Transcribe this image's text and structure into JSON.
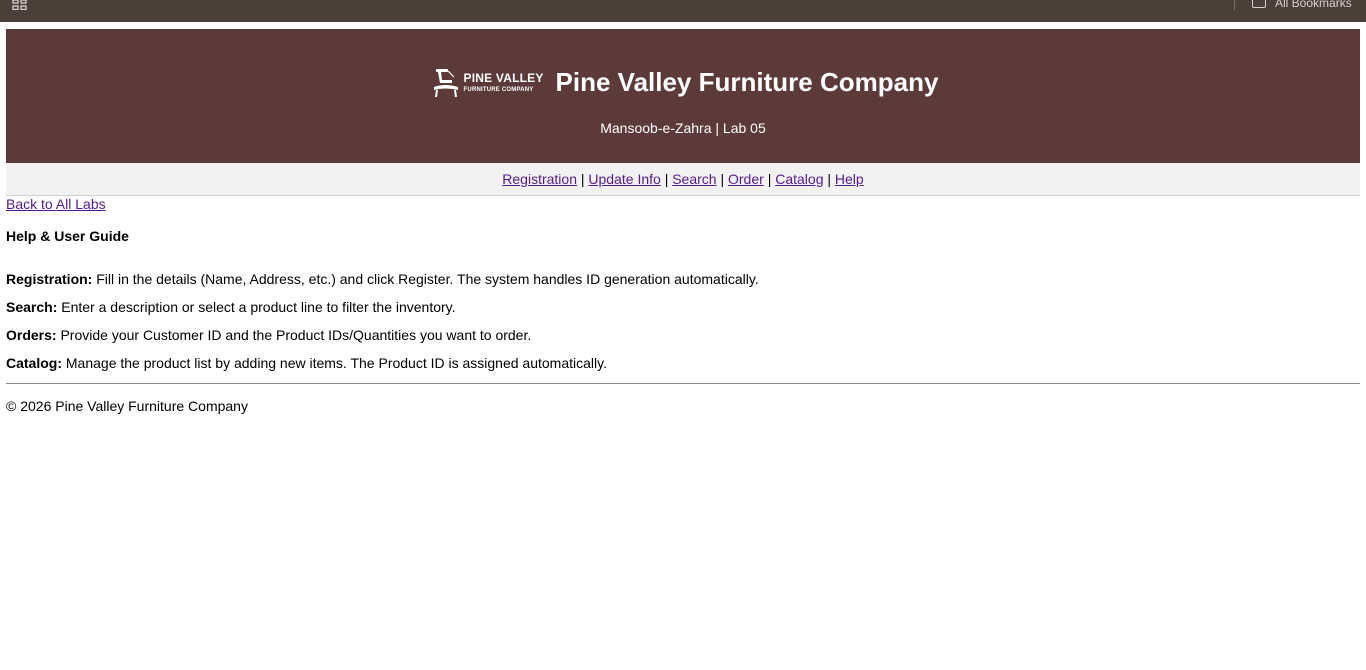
{
  "browser": {
    "bookmarks_label": "All Bookmarks"
  },
  "header": {
    "logo_name": "PINE VALLEY",
    "logo_sub": "FURNITURE COMPANY",
    "title": "Pine Valley Furniture Company",
    "subtitle": "Mansoob-e-Zahra | Lab 05"
  },
  "nav": {
    "items": [
      {
        "label": "Registration"
      },
      {
        "label": "Update Info"
      },
      {
        "label": "Search"
      },
      {
        "label": "Order"
      },
      {
        "label": "Catalog"
      },
      {
        "label": "Help"
      }
    ],
    "separator": "|"
  },
  "back_link": "Back to All Labs",
  "section_title": "Help & User Guide",
  "guide": [
    {
      "term": "Registration:",
      "text": " Fill in the details (Name, Address, etc.) and click Register. The system handles ID generation automatically."
    },
    {
      "term": "Search:",
      "text": " Enter a description or select a product line to filter the inventory."
    },
    {
      "term": "Orders:",
      "text": " Provide your Customer ID and the Product IDs/Quantities you want to order."
    },
    {
      "term": "Catalog:",
      "text": " Manage the product list by adding new items. The Product ID is assigned automatically."
    }
  ],
  "footer": "© 2026 Pine Valley Furniture Company",
  "colors": {
    "header_bg": "#5c3a39",
    "nav_bg": "#f2f2f2",
    "link": "#551a8b",
    "browser_bar": "#4a3f39"
  }
}
